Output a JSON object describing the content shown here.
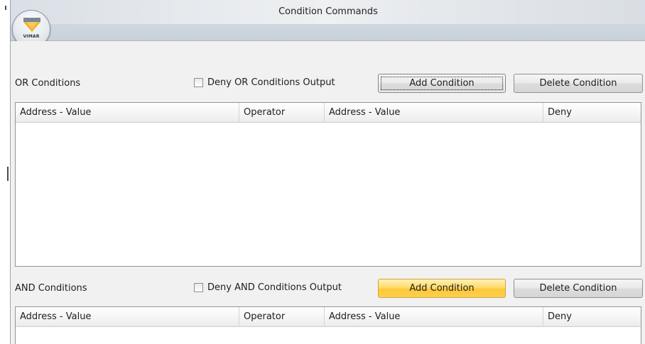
{
  "window": {
    "title": "Condition Commands",
    "logo_text": "VIMAR",
    "logo_color": "#f2b233"
  },
  "or_section": {
    "label": "OR Conditions",
    "deny_label": "Deny OR Conditions Output",
    "deny_checked": false,
    "add_label": "Add Condition",
    "delete_label": "Delete Condition",
    "columns": [
      "Address - Value",
      "Operator",
      "Address - Value",
      "Deny"
    ],
    "rows": []
  },
  "and_section": {
    "label": "AND Conditions",
    "deny_label": "Deny AND Conditions Output",
    "deny_checked": false,
    "add_label": "Add Condition",
    "delete_label": "Delete Condition",
    "columns": [
      "Address - Value",
      "Operator",
      "Address - Value",
      "Deny"
    ],
    "rows": []
  },
  "colors": {
    "hover_button": "#fdc93b",
    "window_bg": "#f1f1f1"
  }
}
